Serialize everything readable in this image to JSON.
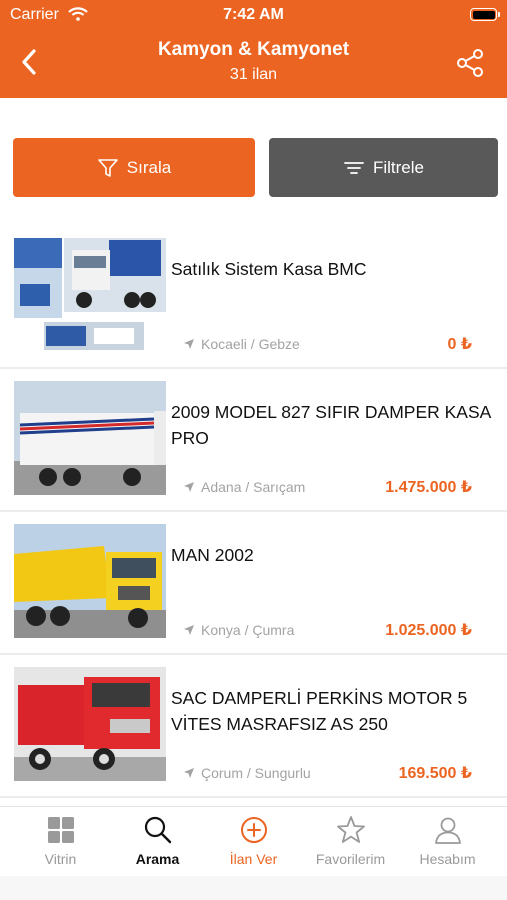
{
  "status": {
    "carrier": "Carrier",
    "time": "7:42 AM"
  },
  "nav": {
    "title": "Kamyon & Kamyonet",
    "subtitle": "31 ilan"
  },
  "actions": {
    "sort_label": "Sırala",
    "filter_label": "Filtrele"
  },
  "listings": [
    {
      "title": "Satılık Sistem Kasa BMC",
      "location": "Kocaeli / Gebze",
      "price": "0 ₺"
    },
    {
      "title": "2009 MODEL 827 SIFIR DAMPER KASA PRO",
      "location": "Adana / Sarıçam",
      "price": "1.475.000 ₺"
    },
    {
      "title": "MAN 2002",
      "location": "Konya / Çumra",
      "price": "1.025.000 ₺"
    },
    {
      "title": "SAC DAMPERLİ PERKİNS MOTOR 5 VİTES MASRAFSIZ AS 250",
      "location": "Çorum / Sungurlu",
      "price": "169.500 ₺"
    }
  ],
  "tabs": [
    {
      "label": "Vitrin",
      "icon": "grid-icon"
    },
    {
      "label": "Arama",
      "icon": "search-icon"
    },
    {
      "label": "İlan Ver",
      "icon": "add-circle-icon"
    },
    {
      "label": "Favorilerim",
      "icon": "star-icon"
    },
    {
      "label": "Hesabım",
      "icon": "user-icon"
    }
  ],
  "colors": {
    "accent": "#EC6421",
    "filter_button": "#595959",
    "muted": "#a3a3a3"
  }
}
